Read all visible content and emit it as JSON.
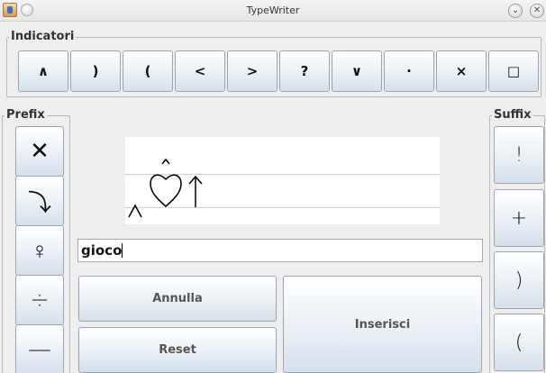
{
  "window": {
    "title": "TypeWriter",
    "minimize_symbol": "⌄",
    "close_symbol": "✕"
  },
  "indicatori": {
    "title": "Indicatori",
    "buttons": [
      "∧",
      ")",
      "(",
      "<",
      ">",
      "?",
      "∨",
      "·",
      "×",
      "□"
    ]
  },
  "prefix": {
    "title": "Prefix",
    "buttons": [
      "✕",
      "⤵",
      "♀",
      "÷",
      "—"
    ]
  },
  "suffix": {
    "title": "Suffix",
    "buttons": [
      "!",
      "+",
      ")",
      "("
    ]
  },
  "preview": {
    "glyphs": [
      "∧",
      "heart-with-hat",
      "↑"
    ]
  },
  "input": {
    "value": "gioco"
  },
  "actions": {
    "annulla": "Annulla",
    "reset": "Reset",
    "inserisci": "Inserisci"
  }
}
